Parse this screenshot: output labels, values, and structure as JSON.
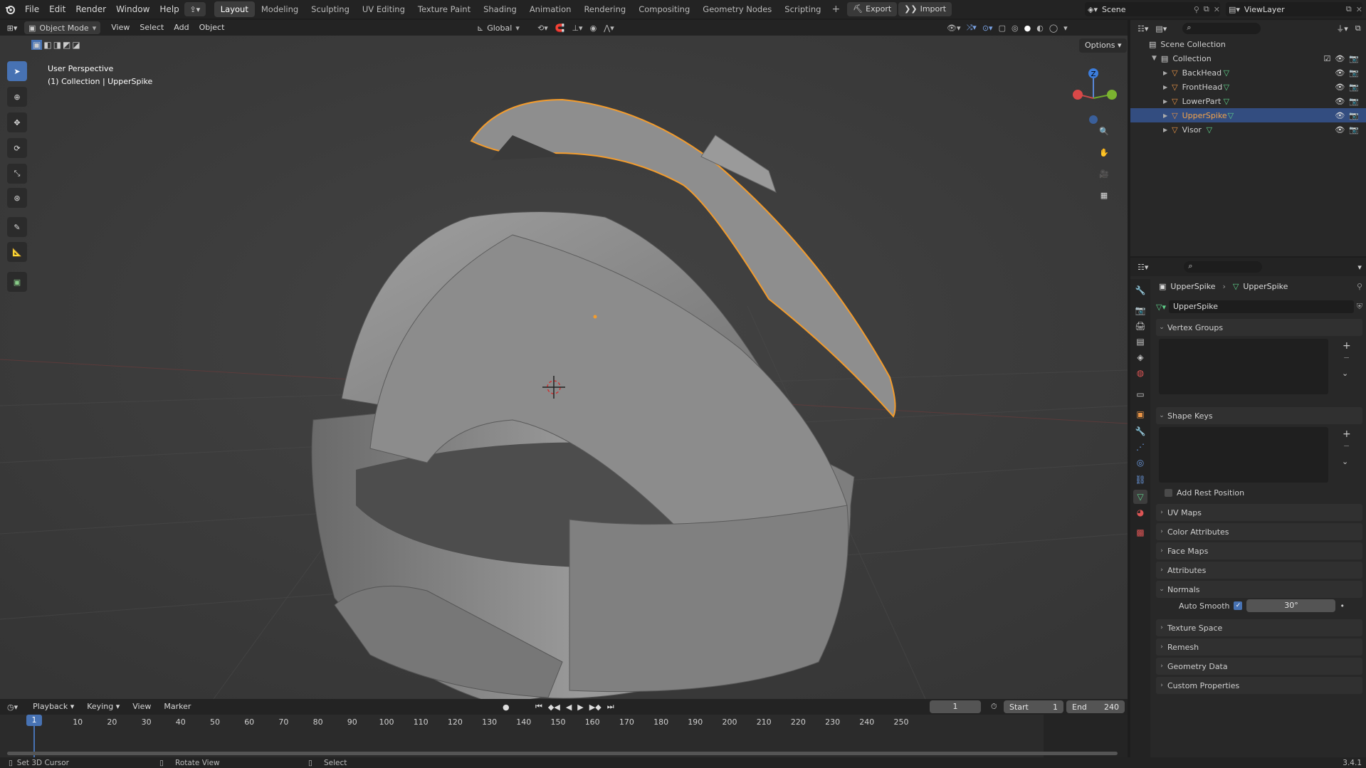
{
  "app": {
    "version": "3.4.1"
  },
  "topbar": {
    "menus": [
      "File",
      "Edit",
      "Render",
      "Window",
      "Help"
    ],
    "workspaces": [
      "Layout",
      "Modeling",
      "Sculpting",
      "UV Editing",
      "Texture Paint",
      "Shading",
      "Animation",
      "Rendering",
      "Compositing",
      "Geometry Nodes",
      "Scripting"
    ],
    "active_workspace": "Layout",
    "export_label": "Export",
    "import_label": "Import",
    "scene": "Scene",
    "view_layer": "ViewLayer"
  },
  "viewport": {
    "mode": "Object Mode",
    "menus": [
      "View",
      "Select",
      "Add",
      "Object"
    ],
    "orientation": "Global",
    "options_label": "Options",
    "info_line1": "User Perspective",
    "info_line2": "(1) Collection | UpperSpike",
    "gizmo_axis": "Z"
  },
  "outliner": {
    "scene_collection": "Scene Collection",
    "collection": "Collection",
    "objects": [
      "BackHead",
      "FrontHead",
      "LowerPart",
      "UpperSpike",
      "Visor"
    ],
    "selected": "UpperSpike"
  },
  "properties": {
    "breadcrumb_object": "UpperSpike",
    "breadcrumb_data": "UpperSpike",
    "mesh_name": "UpperSpike",
    "sections": {
      "vertex_groups": "Vertex Groups",
      "shape_keys": "Shape Keys",
      "add_rest_position": "Add Rest Position",
      "uv_maps": "UV Maps",
      "color_attributes": "Color Attributes",
      "face_maps": "Face Maps",
      "attributes": "Attributes",
      "normals": "Normals",
      "auto_smooth": "Auto Smooth",
      "auto_smooth_angle": "30°",
      "texture_space": "Texture Space",
      "remesh": "Remesh",
      "geometry_data": "Geometry Data",
      "custom_properties": "Custom Properties"
    }
  },
  "timeline": {
    "menus": [
      "Playback",
      "Keying",
      "View",
      "Marker"
    ],
    "current_frame": "1",
    "start_label": "Start",
    "start": "1",
    "end_label": "End",
    "end": "240",
    "ticks": [
      "1",
      "10",
      "20",
      "30",
      "40",
      "50",
      "60",
      "70",
      "80",
      "90",
      "100",
      "110",
      "120",
      "130",
      "140",
      "150",
      "160",
      "170",
      "180",
      "190",
      "200",
      "210",
      "220",
      "230",
      "240",
      "250"
    ]
  },
  "status": {
    "left": "Set 3D Cursor",
    "mid": "Rotate View",
    "right": "Select",
    "version": "3.4.1"
  },
  "colors": {
    "accent": "#4772b3",
    "selection_outline": "#f39c2d",
    "mesh": "#8a8a8a"
  }
}
